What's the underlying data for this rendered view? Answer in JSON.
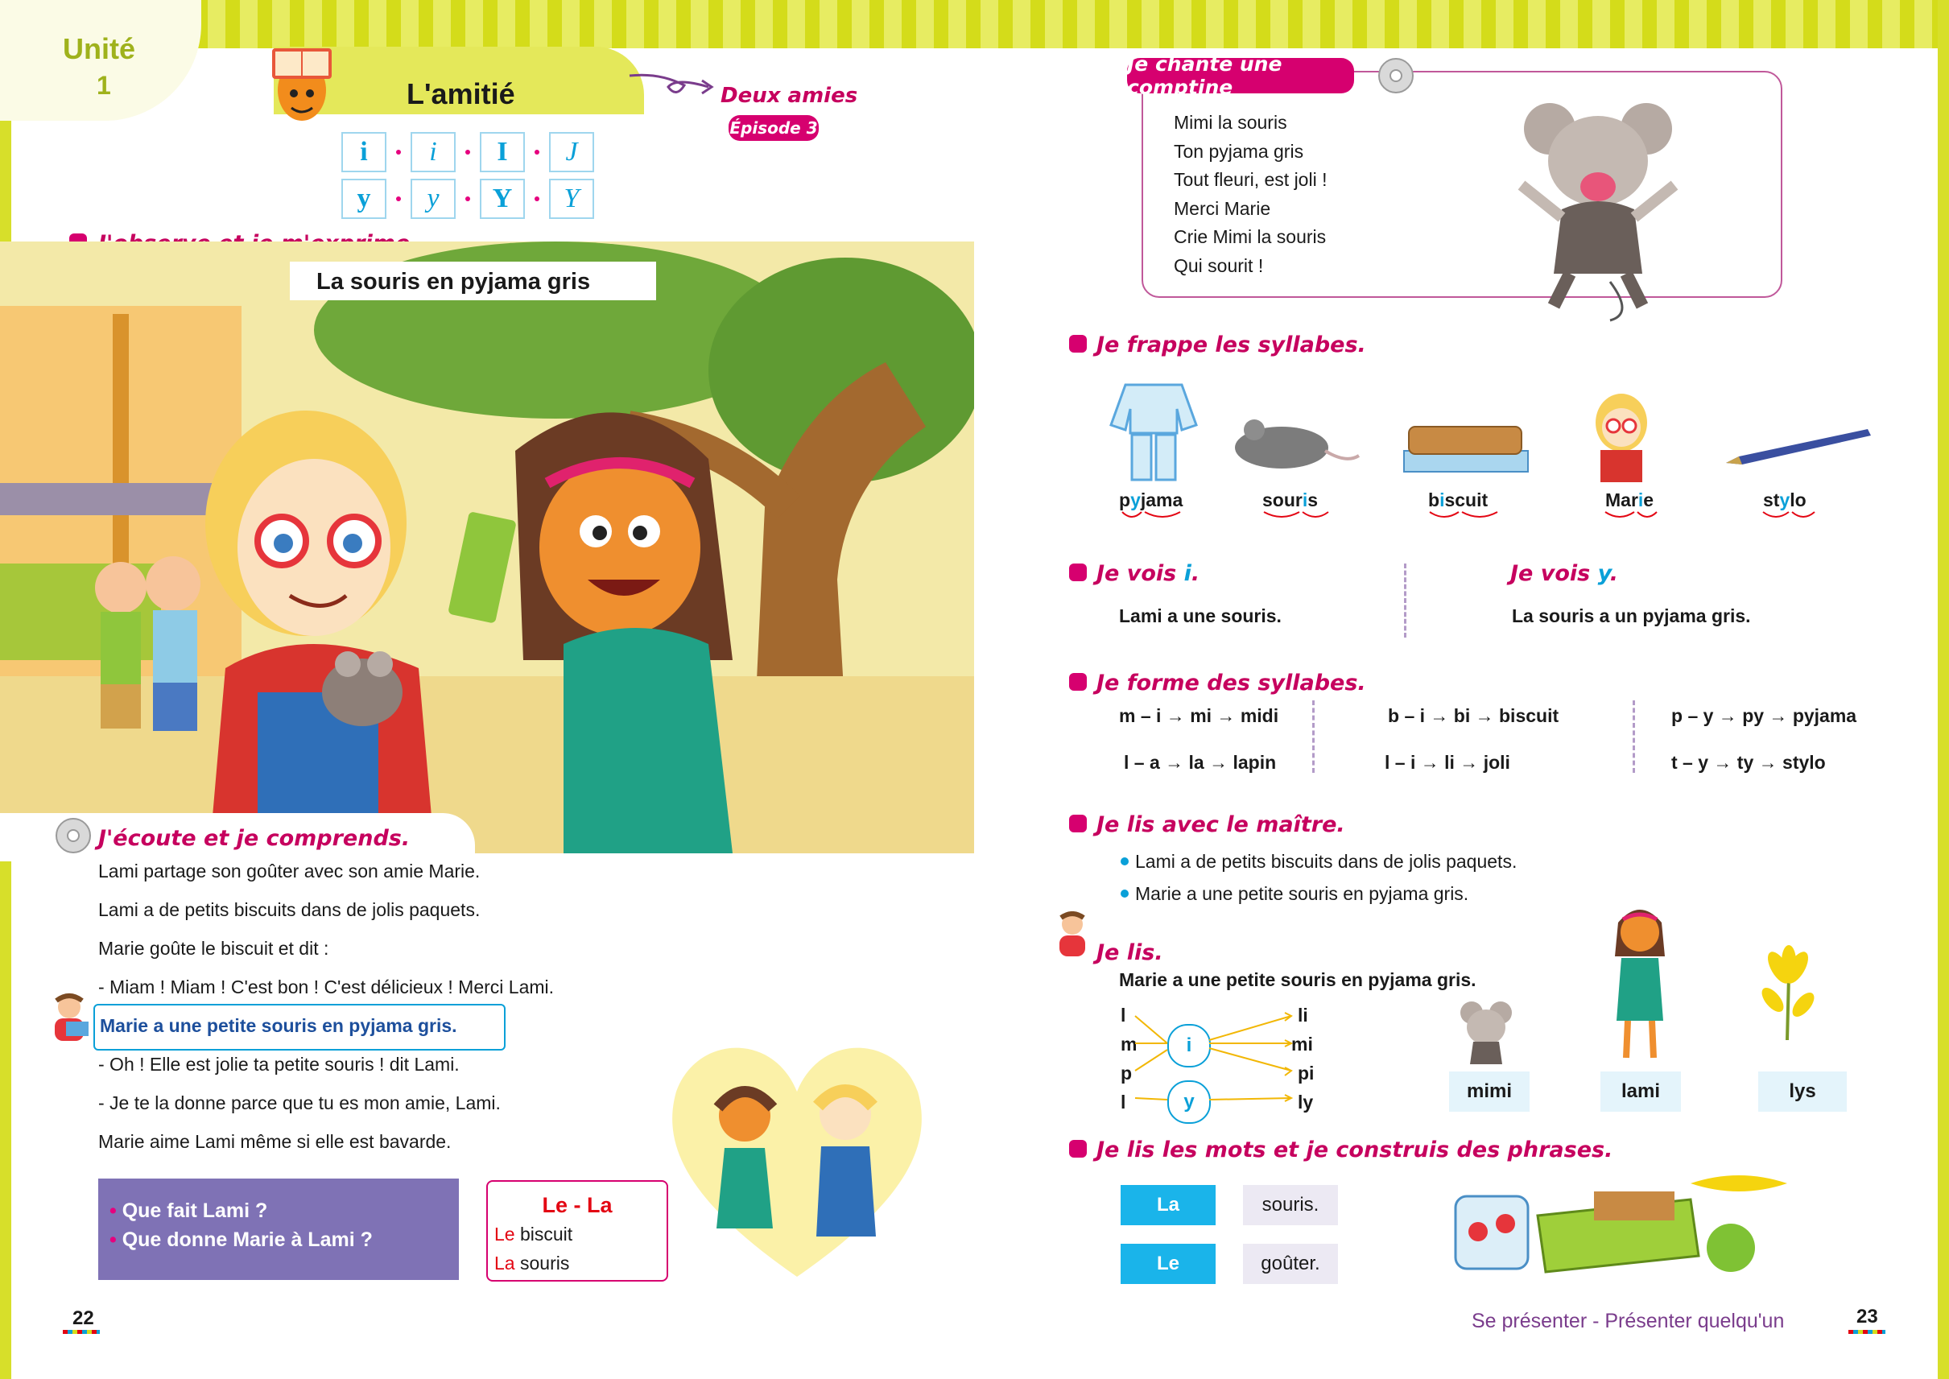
{
  "unit": {
    "word": "Unité",
    "number": "1"
  },
  "title": "L'amitié",
  "episode": {
    "story": "Deux amies",
    "label": "Épisode 3"
  },
  "letters": {
    "row1": [
      "i",
      "i",
      "I",
      "J"
    ],
    "row2": [
      "y",
      "y",
      "Y",
      "Y"
    ]
  },
  "observe": {
    "heading": "J'observe et je m'exprime.",
    "caption": "La souris en pyjama gris"
  },
  "ecoute": {
    "heading": "J'écoute et je comprends.",
    "lines": [
      "Lami partage son goûter avec son amie Marie.",
      "Lami a de petits biscuits dans de jolis paquets.",
      "Marie goûte le biscuit et dit :",
      "- Miam ! Miam ! C'est bon ! C'est  délicieux ! Merci Lami.",
      "Marie a une petite souris en pyjama gris.",
      "- Oh ! Elle est jolie ta petite souris ! dit Lami.",
      "- Je te la donne parce que tu es mon amie, Lami.",
      "Marie aime Lami même si elle est bavarde."
    ]
  },
  "questions": [
    "Que fait Lami ?",
    "Que donne Marie à Lami ?"
  ],
  "articles": {
    "title": "Le - La",
    "items": [
      {
        "art": "Le",
        "word": " biscuit"
      },
      {
        "art": "La",
        "word": " souris"
      }
    ]
  },
  "page_left": "22",
  "comptine": {
    "heading": "Je chante une comptine",
    "lines": [
      "Mimi la souris",
      "Ton pyjama gris",
      "Tout fleuri, est joli !",
      "Merci Marie",
      "Crie Mimi la souris",
      "Qui sourit !"
    ]
  },
  "frappe": {
    "heading": "Je frappe les syllabes.",
    "words": [
      {
        "pre": "p",
        "hl": "y",
        "post": "jama"
      },
      {
        "pre": "sour",
        "hl": "i",
        "post": "s"
      },
      {
        "pre": "b",
        "hl": "i",
        "post": "scuit"
      },
      {
        "pre": "Mar",
        "hl": "i",
        "post": "e"
      },
      {
        "pre": "st",
        "hl": "y",
        "post": "lo"
      }
    ]
  },
  "vois_i": {
    "heading": "Je vois ",
    "letter": "i",
    "end": ".",
    "sentence": "Lami a une souris."
  },
  "vois_y": {
    "heading": "Je vois ",
    "letter": "y",
    "end": ".",
    "sentence": "La souris a un pyjama gris."
  },
  "forme": {
    "heading": "Je forme des syllabes.",
    "rows": [
      [
        "m  –  i →  mi → midi",
        "b  –  i  → bi → biscuit",
        "p – y  → py → pyjama"
      ],
      [
        "l  –  a →  la → lapin",
        "l  –  i  → li → joli",
        "t  –  y  → ty → stylo"
      ]
    ]
  },
  "lis_maitre": {
    "heading": "Je lis avec le maître.",
    "lines": [
      "Lami a de petits biscuits dans de jolis paquets.",
      "Marie a une petite souris en pyjama gris."
    ]
  },
  "lis": {
    "heading": "Je lis.",
    "sentence": "Marie a une petite souris en pyjama gris.",
    "left": [
      "l",
      "m",
      "p",
      "l"
    ],
    "center": [
      "i",
      "y"
    ],
    "right": [
      "li",
      "mi",
      "pi",
      "ly"
    ],
    "words": [
      "mimi",
      "lami",
      "lys"
    ]
  },
  "construis": {
    "heading": "Je lis les mots et je construis des phrases.",
    "articles": [
      "La",
      "Le"
    ],
    "nouns": [
      "souris.",
      "goûter."
    ]
  },
  "footer": "Se présenter - Présenter quelqu'un",
  "page_right": "23",
  "colors": {
    "accent": "#d6006f",
    "blue": "#0aa0d8",
    "red": "#e30613",
    "lime": "#d4dc1a",
    "purple": "#7f72b5"
  }
}
